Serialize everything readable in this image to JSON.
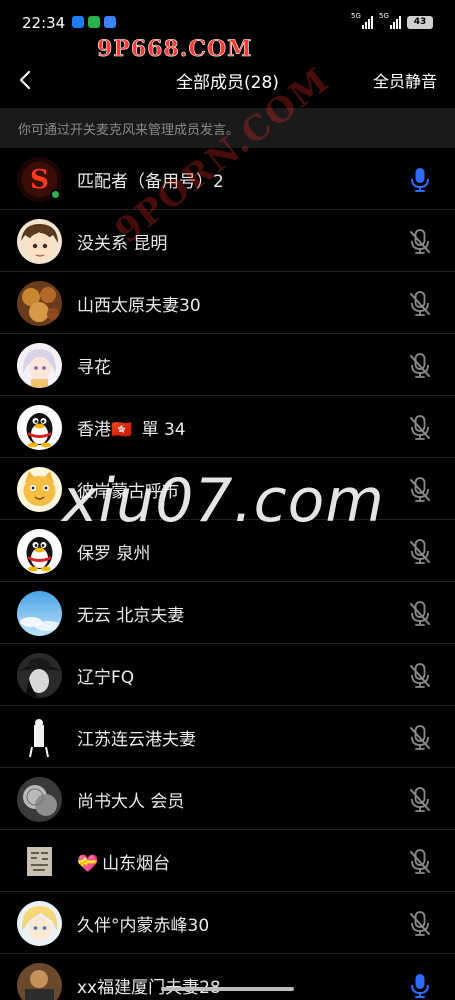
{
  "status_bar": {
    "time": "22:34",
    "signal_1": "5G",
    "signal_2": "5G",
    "battery": "43",
    "app_colors": [
      "#1d7cf2",
      "#2bb24c",
      "#3b82f6"
    ]
  },
  "watermarks": {
    "top": "9P668.COM",
    "diagonal": "9PORN.COM",
    "center": "xiu07.com"
  },
  "nav": {
    "back_icon": "chevron-left-icon",
    "title": "全部成员(28)",
    "action": "全员静音"
  },
  "tip": "你可通过开关麦克风来管理成员发言。",
  "members": [
    {
      "name": "匹配者（备用号）2",
      "mic": "on",
      "avatar": "s-letter",
      "online": true
    },
    {
      "name": "没关系 昆明",
      "mic": "off",
      "avatar": "anime-boy"
    },
    {
      "name": "山西太原夫妻30",
      "mic": "off",
      "avatar": "food"
    },
    {
      "name": "寻花",
      "mic": "off",
      "avatar": "anime-girl"
    },
    {
      "name": "香港",
      "emoji": "🇭🇰",
      "name_suffix": " 單 34",
      "mic": "off",
      "avatar": "penguin"
    },
    {
      "name": "彼岸蒙古呼市",
      "mic": "off",
      "avatar": "cat"
    },
    {
      "name": "保罗 泉州",
      "mic": "off",
      "avatar": "penguin"
    },
    {
      "name": "无云 北京夫妻",
      "mic": "off",
      "avatar": "sky"
    },
    {
      "name": "辽宁FQ",
      "mic": "off",
      "avatar": "hat-girl"
    },
    {
      "name": "江苏连云港夫妻",
      "mic": "off",
      "avatar": "figure"
    },
    {
      "name": "尚书大人 会员",
      "mic": "off",
      "avatar": "coins"
    },
    {
      "name": "山东烟台",
      "emoji": "💝",
      "mic": "off",
      "avatar": "calligraphy"
    },
    {
      "name": "久伴°内蒙赤峰30",
      "mic": "off",
      "avatar": "blonde"
    },
    {
      "name": "xx福建厦门夫妻28",
      "mic": "on",
      "avatar": "partial"
    }
  ]
}
